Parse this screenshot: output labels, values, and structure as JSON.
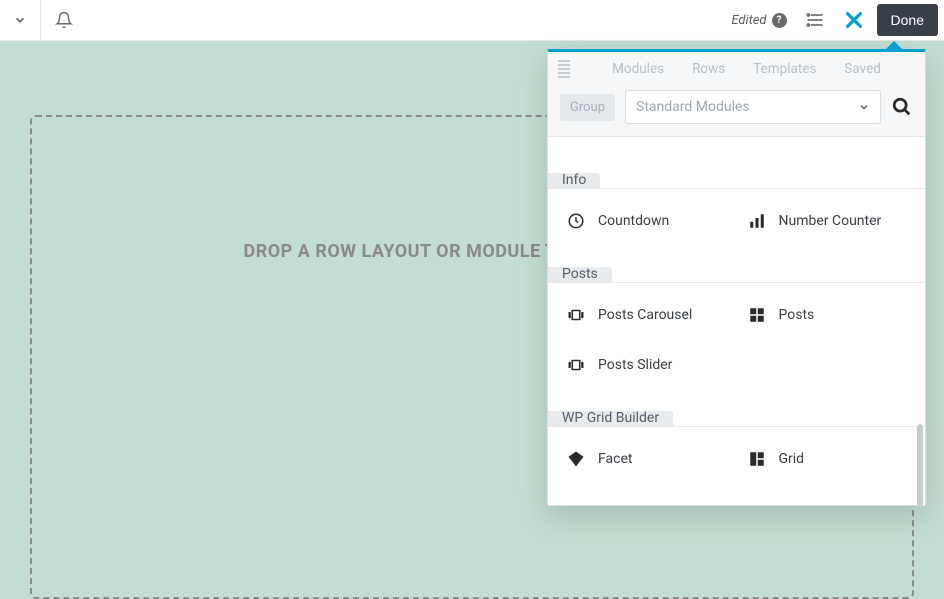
{
  "topbar": {
    "edited_label": "Edited",
    "done_label": "Done"
  },
  "dropzone": {
    "hint": "DROP A ROW LAYOUT OR MODULE TO GET STARTED!"
  },
  "panel": {
    "tabs": {
      "modules": "Modules",
      "rows": "Rows",
      "templates": "Templates",
      "saved": "Saved"
    },
    "group_label": "Group",
    "select_value": "Standard Modules",
    "sections": [
      {
        "title": "Info",
        "items": [
          {
            "label": "Countdown",
            "icon": "clock"
          },
          {
            "label": "Number Counter",
            "icon": "bars"
          }
        ]
      },
      {
        "title": "Posts",
        "items": [
          {
            "label": "Posts Carousel",
            "icon": "carousel"
          },
          {
            "label": "Posts",
            "icon": "grid2"
          },
          {
            "label": "Posts Slider",
            "icon": "slider"
          }
        ]
      },
      {
        "title": "WP Grid Builder",
        "items": [
          {
            "label": "Facet",
            "icon": "diamond"
          },
          {
            "label": "Grid",
            "icon": "grid3"
          }
        ]
      }
    ]
  }
}
